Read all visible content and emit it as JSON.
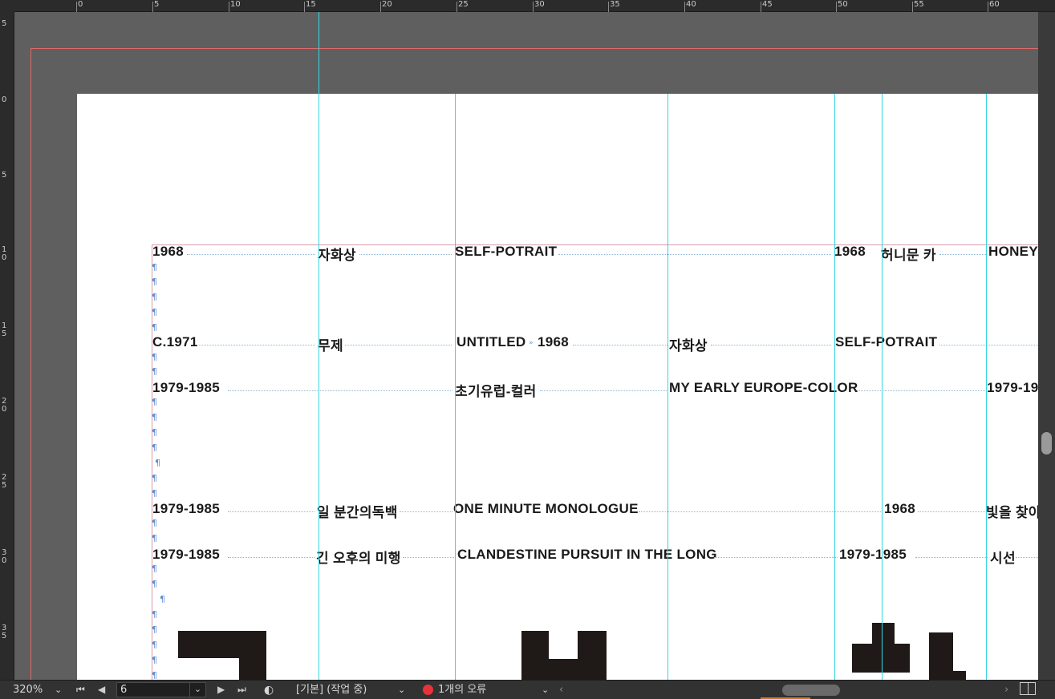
{
  "ruler": {
    "top_labels": [
      "0",
      "5",
      "10",
      "15",
      "20",
      "25",
      "30",
      "35",
      "40",
      "45",
      "50",
      "55",
      "60"
    ],
    "left_labels": [
      "5",
      "0",
      "5",
      "1\n0",
      "1\n5",
      "2\n0",
      "2\n5",
      "3\n0",
      "3\n5"
    ]
  },
  "document": {
    "rows": [
      {
        "cells": [
          "1968",
          "자화상",
          "SELF-POTRAIT",
          "1968",
          "허니문 카",
          "HONEYM"
        ]
      },
      {
        "cells": [
          "C.1971",
          "무제",
          "UNTITLED",
          "1968",
          "자화상",
          "SELF-POTRAIT"
        ]
      },
      {
        "cells": [
          "1979-1985",
          "초기유럽-컬러",
          "MY EARLY EUROPE-COLOR",
          "1979-19"
        ]
      },
      {
        "cells": [
          "1979-1985",
          "일 분간의독백",
          "ONE MINUTE MONOLOGUE",
          "1968",
          "빛을 찾아"
        ]
      },
      {
        "cells": [
          "1979-1985",
          "긴 오후의 미행",
          "CLANDESTINE PURSUIT IN THE LONG",
          "1979-1985",
          "시선"
        ]
      }
    ],
    "pilcrow": "¶",
    "tab_mark": "»"
  },
  "statusbar": {
    "zoom": "320%",
    "page_number": "6",
    "profile": "[기본] (작업 중)",
    "error_text": "1개의 오류"
  },
  "icons": {
    "first_page": "first-page-icon",
    "prev_page": "prev-page-icon",
    "next_page": "next-page-icon",
    "last_page": "last-page-icon",
    "preflight": "preflight-icon",
    "split_view": "split-view-icon"
  },
  "colors": {
    "guide": "#35d7e0",
    "bleed": "#e06a6a",
    "error": "#e8323a",
    "pasteboard": "#5f5f5f"
  }
}
